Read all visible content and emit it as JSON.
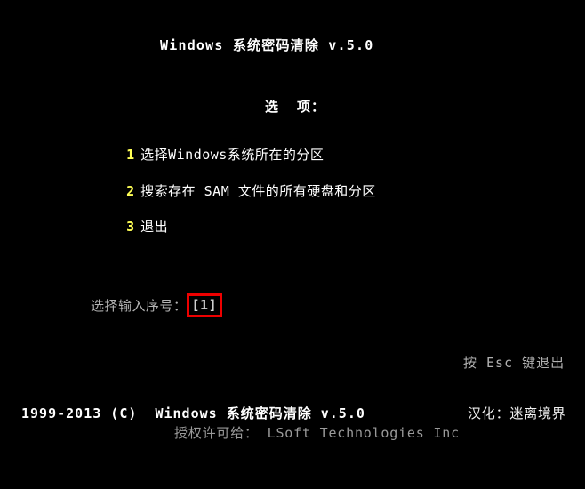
{
  "screen": {
    "background_color": "#000000",
    "foreground_color": "#ffffff",
    "accent_yellow": "#ffff55",
    "highlight_box_color": "#ee0000",
    "dim_color": "#aaaaaa"
  },
  "title": "Windows 系统密码清除 v.5.0",
  "options_header": "选  项：",
  "options": [
    {
      "number": "1",
      "label": "选择Windows系统所在的分区"
    },
    {
      "number": "2",
      "label": "搜索存在 SAM 文件的所有硬盘和分区"
    },
    {
      "number": "3",
      "label": "退出"
    }
  ],
  "prompt": {
    "label": "选择输入序号：",
    "value": "[1]"
  },
  "esc_hint": "按 Esc 键退出",
  "footer": {
    "copyright": "1999-2013 (C)  Windows 系统密码清除 v.5.0",
    "license": "授权许可给： LSoft Technologies Inc",
    "translator": "汉化：迷离境界"
  }
}
